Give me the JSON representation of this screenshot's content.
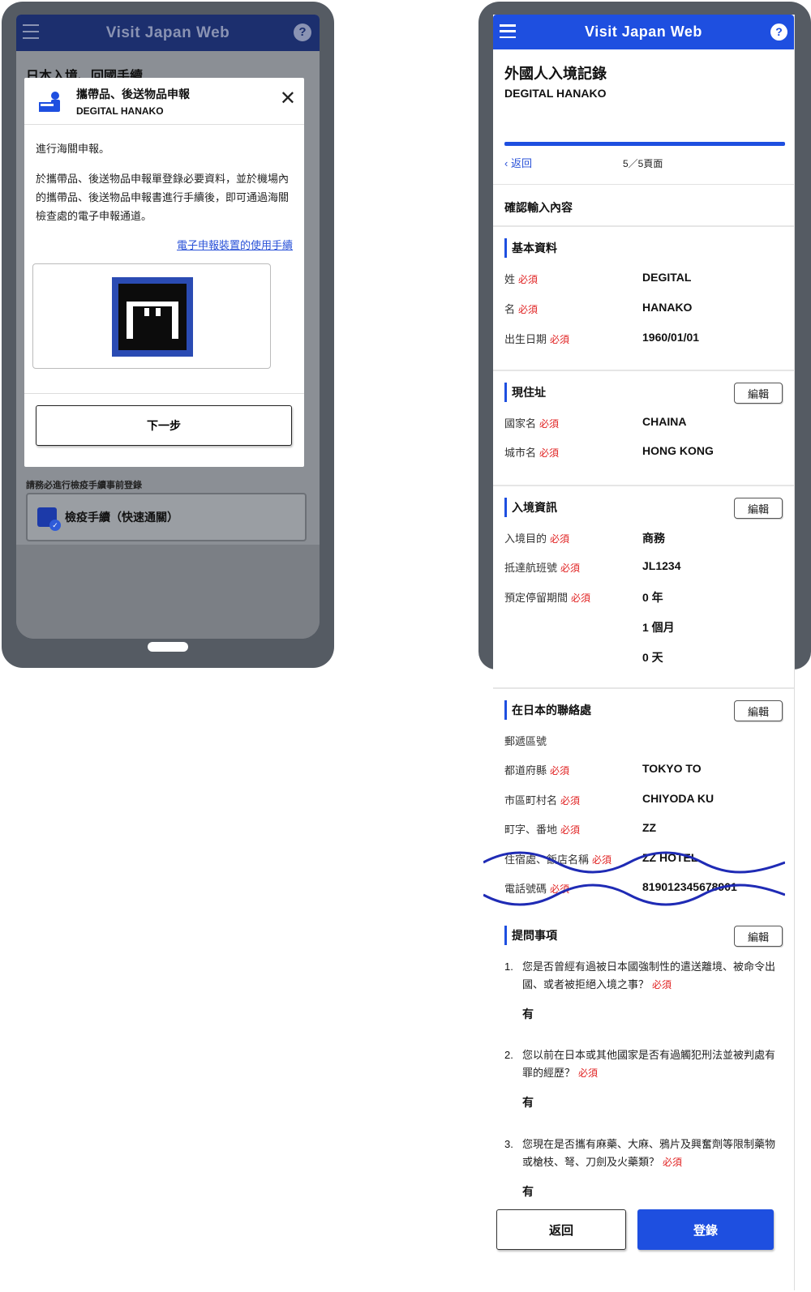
{
  "left_phone": {
    "header": {
      "title": "Visit Japan Web",
      "help": "?"
    },
    "background": {
      "page_title": "日本入境、回國手續",
      "note": "請務必進行檢疫手續事前登錄",
      "card_label": "檢疫手續（快速通關）"
    },
    "modal": {
      "title": "攜帶品、後送物品申報",
      "user": "DEGITAL HANAKO",
      "close": "✕",
      "body_line1": "進行海關申報。",
      "body_line2": "於攜帶品、後送物品申報單登錄必要資料，並於機場內的攜帶品、後送物品申報書進行手續後，即可通過海關檢查處的電子申報通道。",
      "link": "電子申報裝置的使用手續",
      "next_button": "下一步"
    }
  },
  "right_phone": {
    "header": {
      "title": "Visit Japan Web",
      "help": "?"
    },
    "record_title": "外國人入境記錄",
    "user": "DEGITAL HANAKO",
    "back_link": "返回",
    "page_indicator": "5／5頁面",
    "confirm_heading": "確認輸入內容",
    "required_tag": "必須",
    "edit_label": "編輯",
    "basic": {
      "title": "基本資料",
      "surname_label": "姓",
      "surname": "DEGITAL",
      "given_label": "名",
      "given": "HANAKO",
      "dob_label": "出生日期",
      "dob": "1960/01/01"
    },
    "address": {
      "title": "現住址",
      "country_label": "國家名",
      "country": "CHAINA",
      "city_label": "城市名",
      "city": "HONG KONG"
    },
    "entry": {
      "title": "入境資訊",
      "purpose_label": "入境目的",
      "purpose": "商務",
      "flight_label": "抵達航班號",
      "flight": "JL1234",
      "stay_label": "預定停留期間",
      "stay_years": "0 年",
      "stay_months": "1 個月",
      "stay_days": "0 天"
    },
    "contact": {
      "title": "在日本的聯絡處",
      "postal_label": "郵遞區號",
      "prefecture_label": "都道府縣",
      "prefecture": "TOKYO TO",
      "city_label": "市區町村名",
      "city": "CHIYODA KU",
      "street_label": "町字、番地",
      "street": "ZZ",
      "hotel_label": "住宿處、飯店名稱",
      "hotel": "ZZ HOTEL",
      "phone_label": "電話號碼",
      "phone": "819012345678901"
    },
    "questions": {
      "title": "提問事項",
      "items": [
        {
          "num": "1.",
          "text": "您是否曾經有過被日本國強制性的遣送離境、被命令出國、或者被拒絕入境之事？",
          "answer": "有"
        },
        {
          "num": "2.",
          "text": "您以前在日本或其他國家是否有過觸犯刑法並被判處有罪的經歷？",
          "answer": "有"
        },
        {
          "num": "3.",
          "text": "您現在是否攜有麻藥、大麻、鴉片及興奮劑等限制藥物或槍枝、弩、刀劍及火藥類？",
          "answer": "有"
        }
      ]
    },
    "back_button": "返回",
    "register_button": "登錄"
  },
  "colors": {
    "brand_blue": "#1e4fe0",
    "dim_header": "#1c2f6e",
    "required_red": "#e02020"
  }
}
